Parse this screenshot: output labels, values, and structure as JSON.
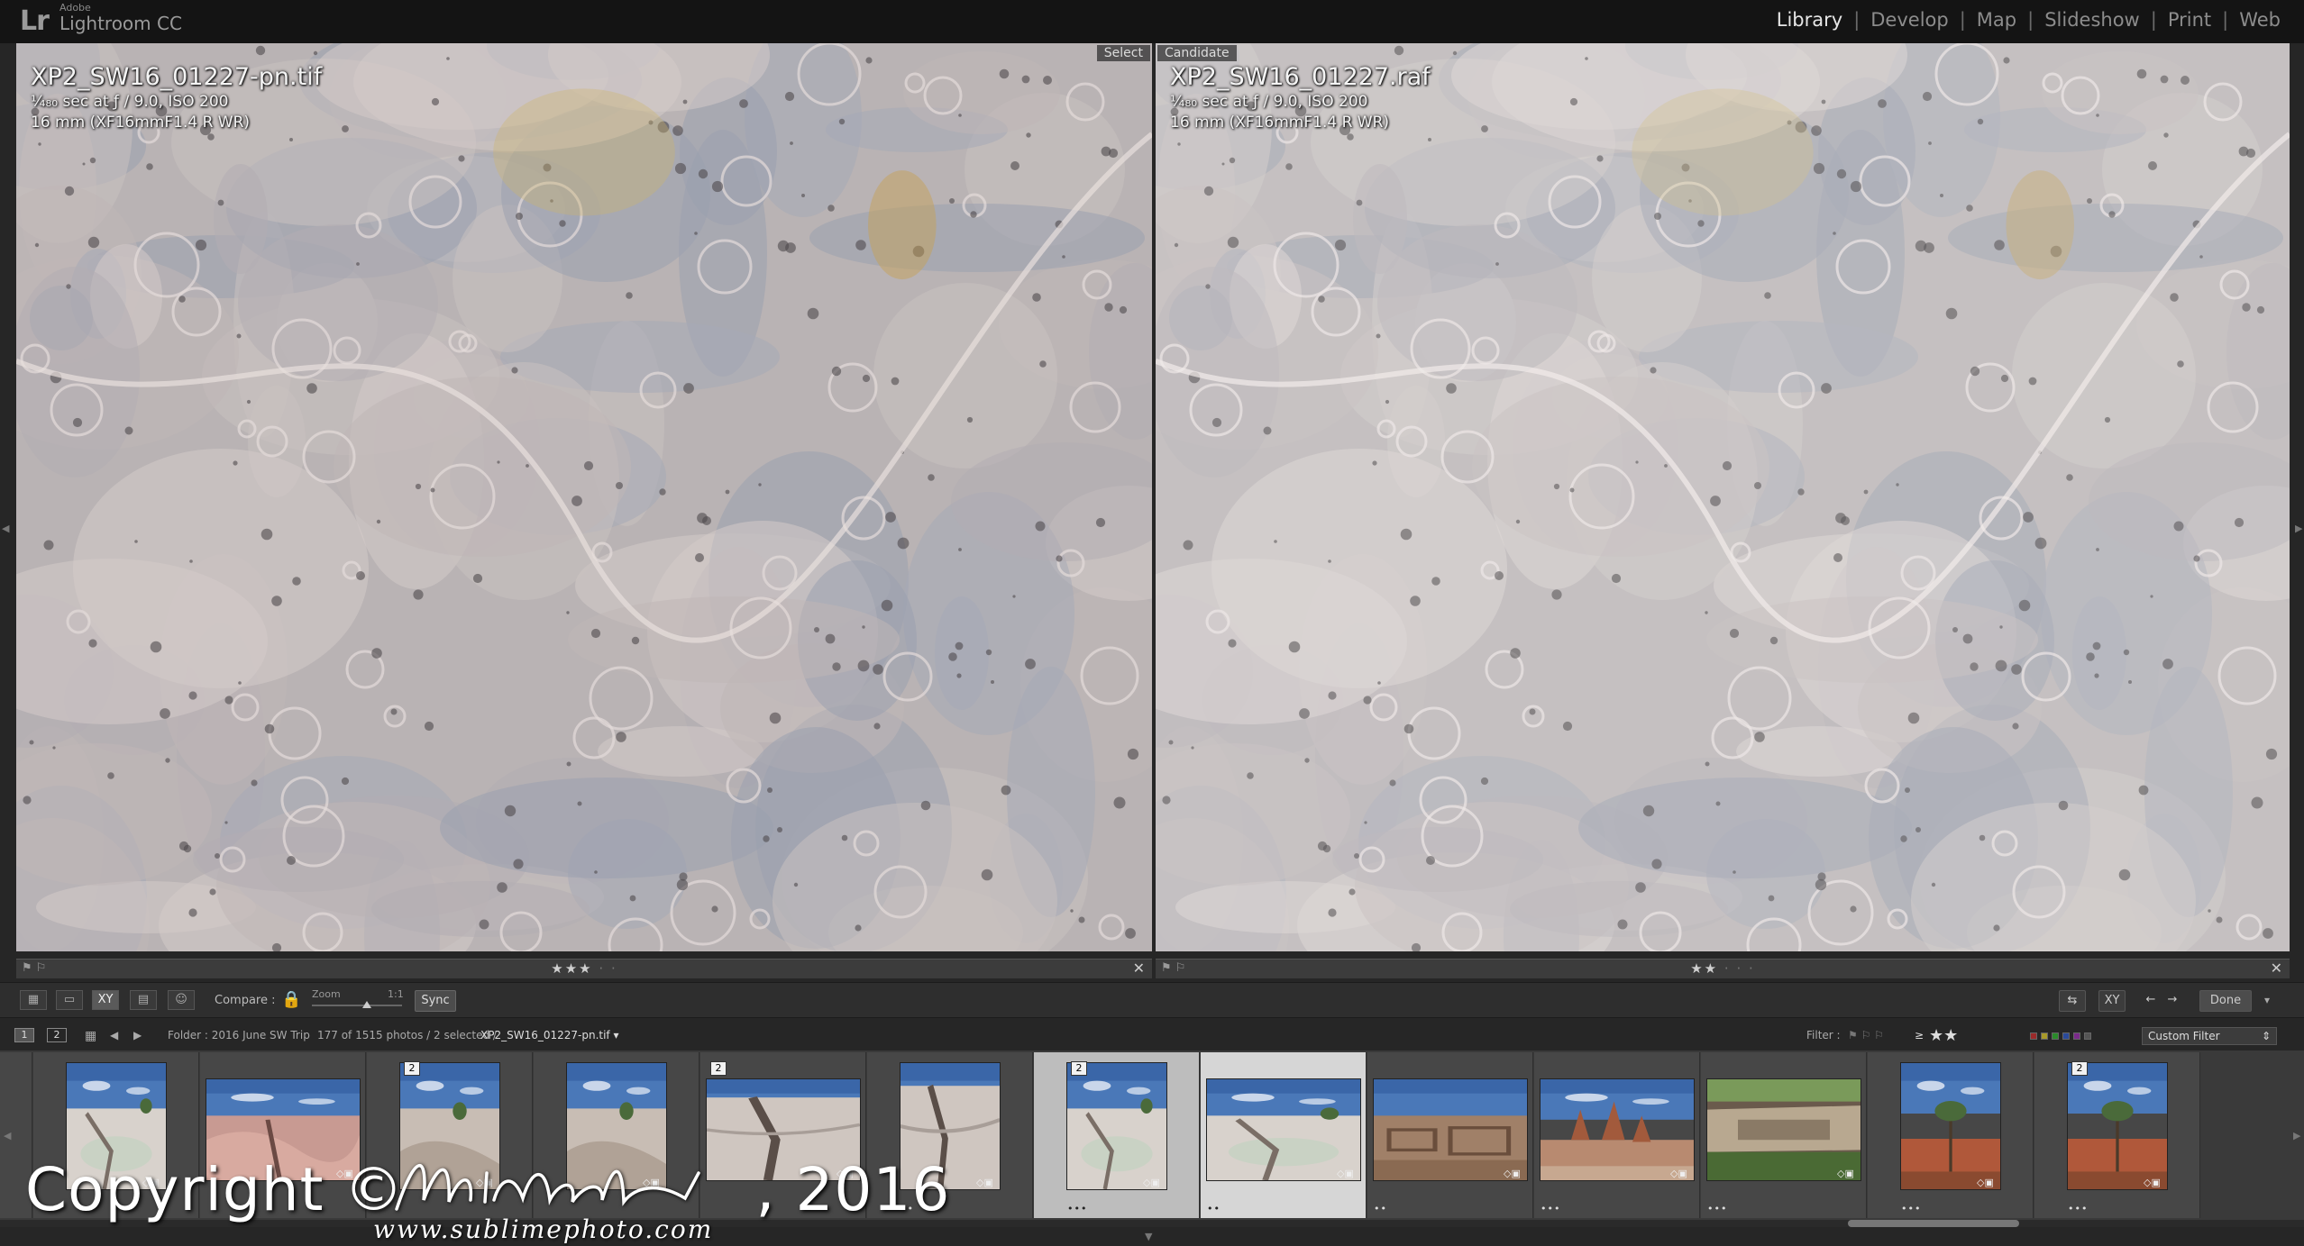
{
  "app": {
    "logo": "Lr",
    "vendor": "Adobe",
    "name": "Lightroom CC"
  },
  "modules": [
    {
      "label": "Library",
      "active": true
    },
    {
      "label": "Develop",
      "active": false
    },
    {
      "label": "Map",
      "active": false
    },
    {
      "label": "Slideshow",
      "active": false
    },
    {
      "label": "Print",
      "active": false
    },
    {
      "label": "Web",
      "active": false
    }
  ],
  "module_separator": "|",
  "compare": {
    "select": {
      "label": "Select",
      "filename": "XP2_SW16_01227-pn.tif",
      "exposure": "¹⁄₄₈₀ sec at ƒ / 9.0, ISO 200",
      "lens": "16 mm (XF16mmF1.4 R WR)",
      "stars": "★★★",
      "dots": "· ·"
    },
    "candidate": {
      "label": "Candidate",
      "filename": "XP2_SW16_01227.raf",
      "exposure": "¹⁄₄₈₀ sec at ƒ / 9.0, ISO 200",
      "lens": "16 mm (XF16mmF1.4 R WR)",
      "stars": "★★",
      "dots": "· · ·"
    }
  },
  "toolbar": {
    "compare_label": "Compare :",
    "zoom_label": "Zoom",
    "zoom_one_to_one": "1:1",
    "sync_label": "Sync",
    "done_label": "Done"
  },
  "navbar": {
    "monitor1": "1",
    "monitor2": "2",
    "folder": "Folder : 2016 June SW Trip",
    "count": "177 of 1515 photos / 2 selected /",
    "current_file": "XP2_SW16_01227-pn.tif ▾",
    "filter_label": "Filter :",
    "filter_gte": "≥",
    "filter_stars": "★★",
    "custom_filter": "Custom Filter"
  },
  "filmstrip": [
    {
      "stack": "",
      "stars": "",
      "scene": "rock"
    },
    {
      "stack": "",
      "stars": "",
      "scene": "pool"
    },
    {
      "stack": "",
      "stars": "",
      "scene": "pink"
    },
    {
      "stack": "2",
      "stars": "",
      "scene": "rock"
    },
    {
      "stack": "",
      "stars": "",
      "scene": "rock"
    },
    {
      "stack": "2",
      "stars": "",
      "scene": "crack"
    },
    {
      "stack": "",
      "stars": "••",
      "scene": "crack"
    },
    {
      "stack": "2",
      "stars": "•••",
      "scene": "pool"
    },
    {
      "stack": "",
      "stars": "••",
      "scene": "pool"
    },
    {
      "stack": "",
      "stars": "••",
      "scene": "ruins"
    },
    {
      "stack": "",
      "stars": "•••",
      "scene": "hoodoo"
    },
    {
      "stack": "",
      "stars": "•••",
      "scene": "cliff"
    },
    {
      "stack": "",
      "stars": "•••",
      "scene": "tree"
    },
    {
      "stack": "2",
      "stars": "•••",
      "scene": "tree"
    }
  ],
  "watermark": {
    "copyright": "Copyright ©",
    "year": ", 2016",
    "url": "www.sublimephoto.com"
  },
  "colors": {
    "accent_lock": "#c9a34a",
    "active_module": "#e6e6e6",
    "panel_bg": "#262626"
  }
}
